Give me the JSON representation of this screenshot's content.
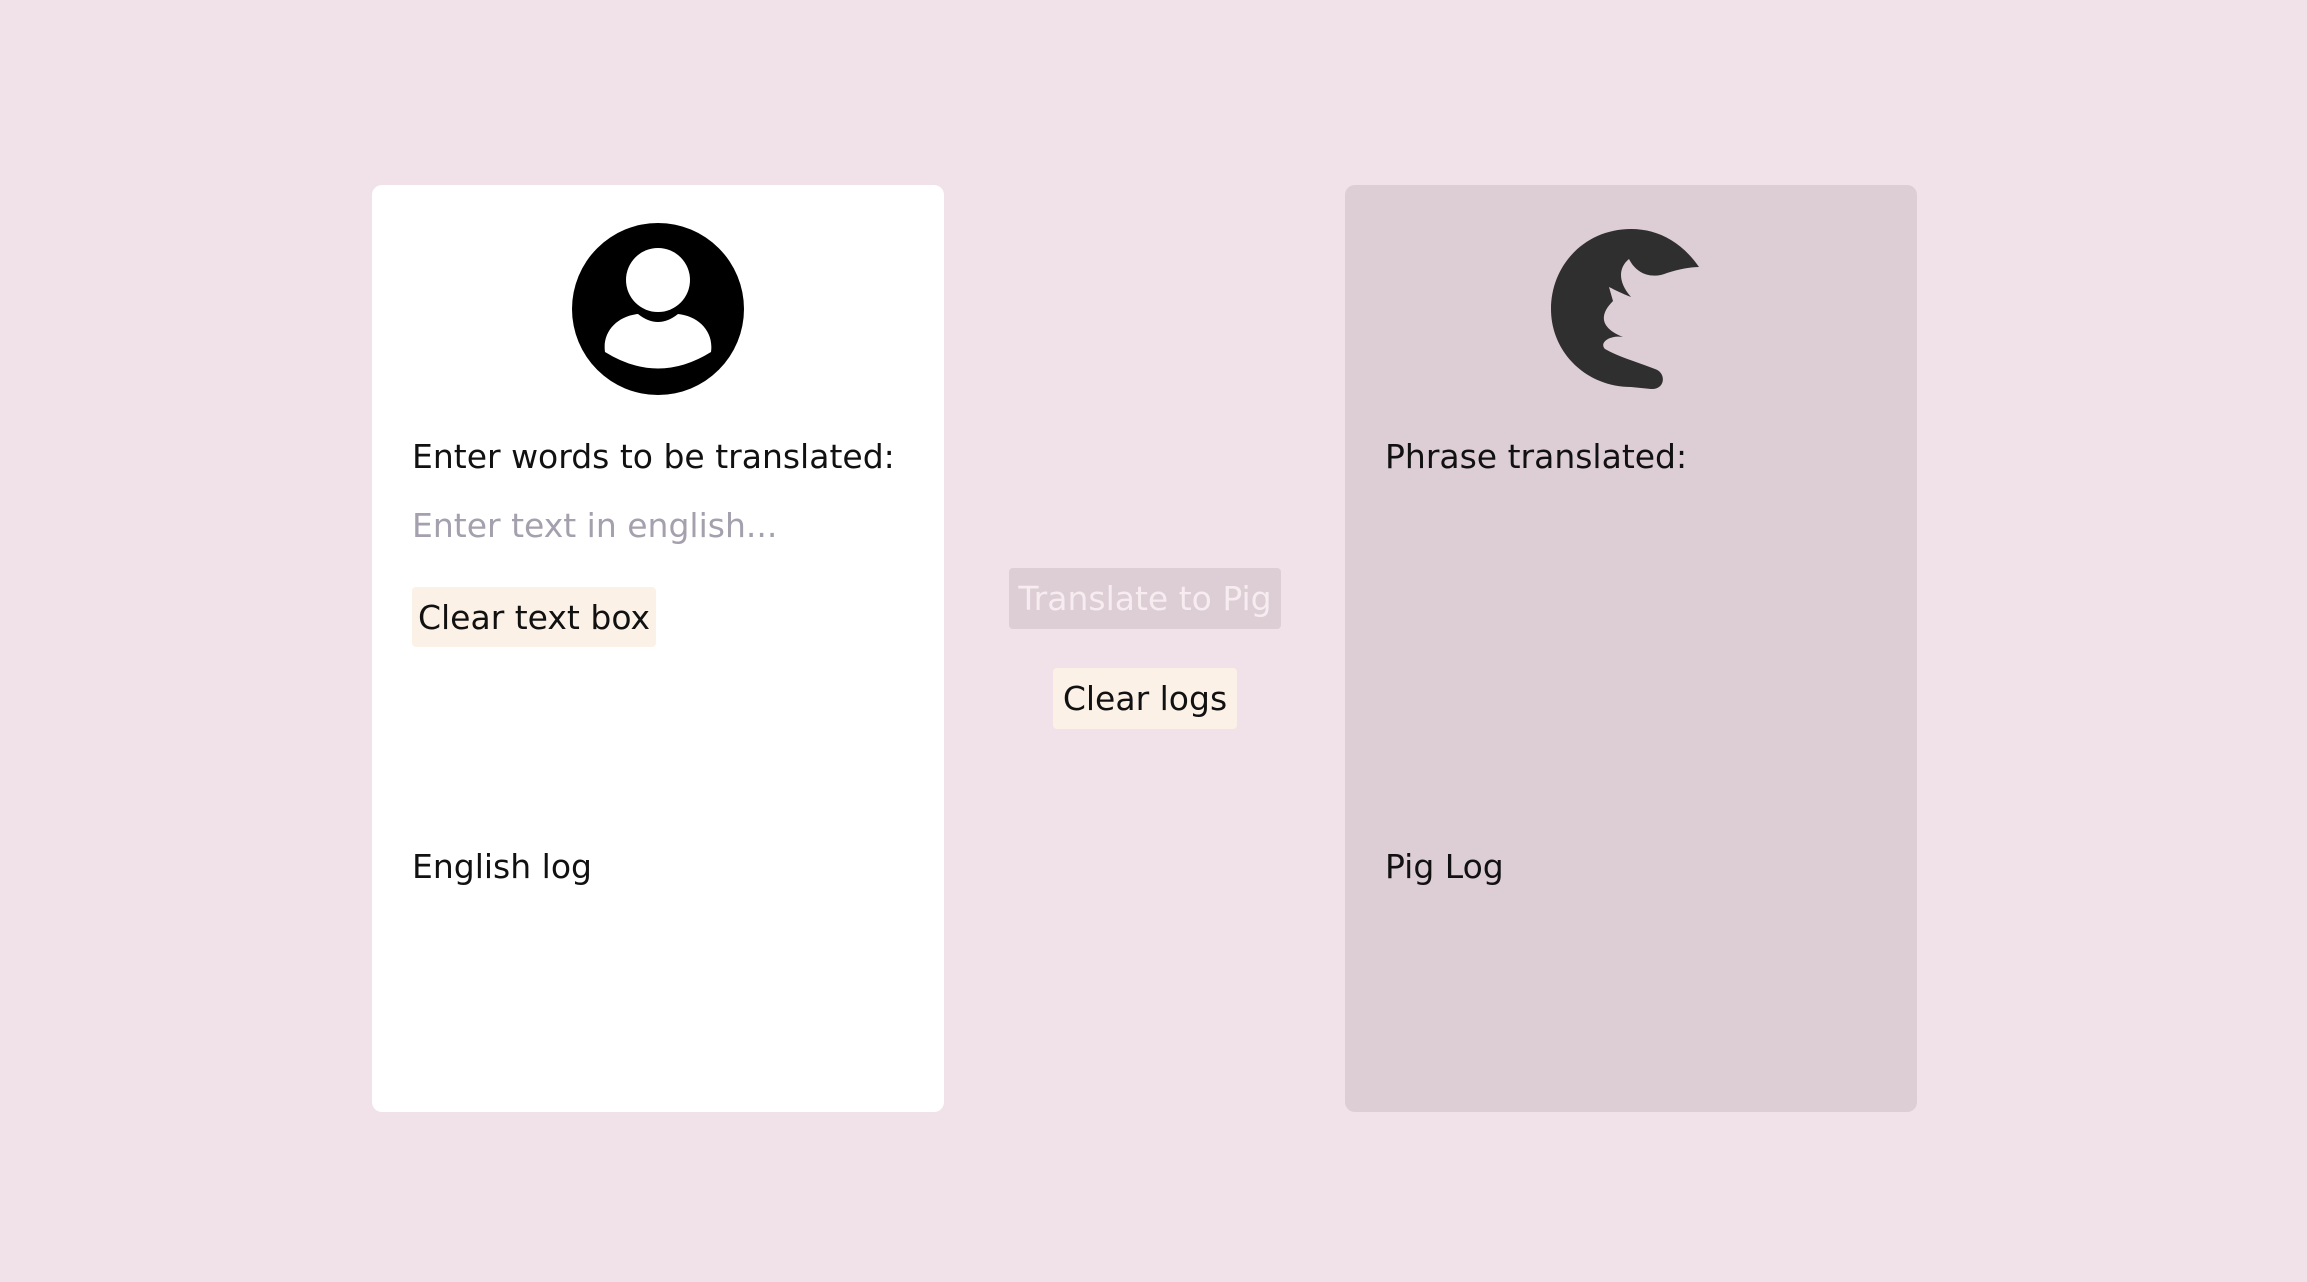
{
  "english_panel": {
    "icon": "user-avatar-icon",
    "prompt_label": "Enter words to be translated:",
    "input_value": "",
    "input_placeholder": "Enter text in english...",
    "clear_button_label": "Clear text box",
    "log_label": "English log"
  },
  "controls": {
    "translate_label": "Translate to Pig",
    "clear_logs_label": "Clear logs"
  },
  "pig_panel": {
    "icon": "pig-head-icon",
    "result_label": "Phrase translated:",
    "log_label": "Pig Log"
  },
  "colors": {
    "page_background": "#f0e2e8",
    "english_panel_background": "#ffffff",
    "pig_panel_background": "#ddcdd5",
    "button_background": "#fcf1e6",
    "disabled_button_background": "#ddcdd5",
    "placeholder_text": "#a4a0ad"
  }
}
